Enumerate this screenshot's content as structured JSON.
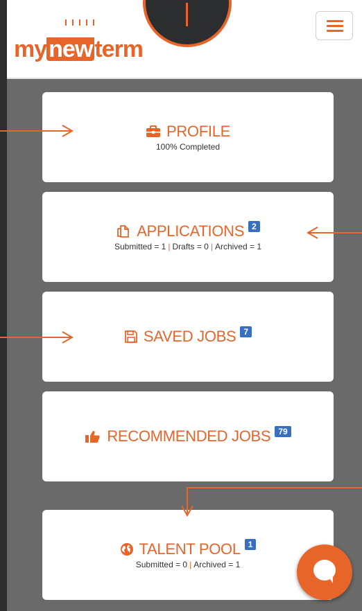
{
  "header": {
    "logo_text_my": "my",
    "logo_text_new": "new",
    "logo_text_term": "term",
    "menu_icon": "hamburger-icon"
  },
  "cards": {
    "profile": {
      "icon": "briefcase-icon",
      "label": "PROFILE",
      "sub": "100% Completed"
    },
    "applications": {
      "icon": "copy-icon",
      "label": "APPLICATIONS",
      "count": "2",
      "submitted": "Submitted = 1",
      "drafts": "Drafts = 0",
      "archived": "Archived = 1",
      "separator": "|"
    },
    "saved_jobs": {
      "icon": "save-icon",
      "label": "SAVED JOBS",
      "count": "7"
    },
    "recommended_jobs": {
      "icon": "thumbs-up-icon",
      "label": "RECOMMENDED JOBS",
      "count": "79"
    },
    "talent_pool": {
      "icon": "globe-icon",
      "label": "TALENT POOL",
      "count": "1",
      "submitted": "Submitted = 0",
      "archived": "Archived = 1",
      "separator": "|"
    }
  },
  "chat": {
    "icon": "chat-bubble-icon"
  },
  "colors": {
    "accent": "#e8652a",
    "count_badge": "#3a6fc0",
    "background": "#6a6a6a",
    "frame": "#2c2d2f"
  }
}
